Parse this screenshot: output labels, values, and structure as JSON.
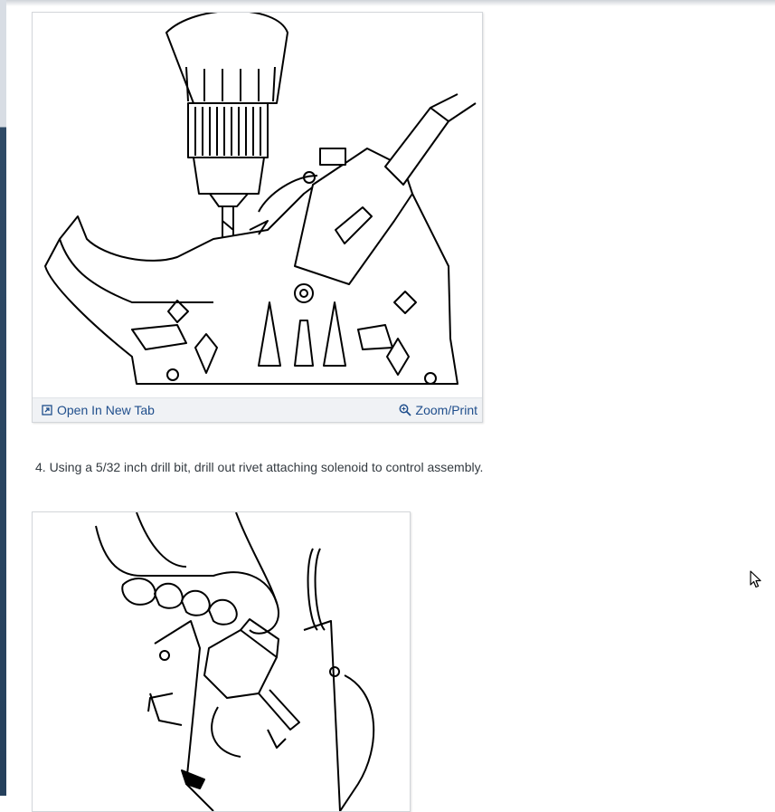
{
  "figure1": {
    "open_label": "Open In New Tab",
    "zoom_label": "Zoom/Print"
  },
  "instruction": {
    "text": "4. Using a 5/32 inch drill bit, drill out rivet attaching solenoid to control assembly."
  },
  "icons": {
    "open_tab": "open-in-new-tab-icon",
    "zoom": "magnifier-zoom-icon",
    "cursor": "mouse-pointer-icon"
  },
  "colors": {
    "link": "#1f4e8c",
    "toolbar_bg": "#f0f2f5",
    "text": "#333a40"
  }
}
